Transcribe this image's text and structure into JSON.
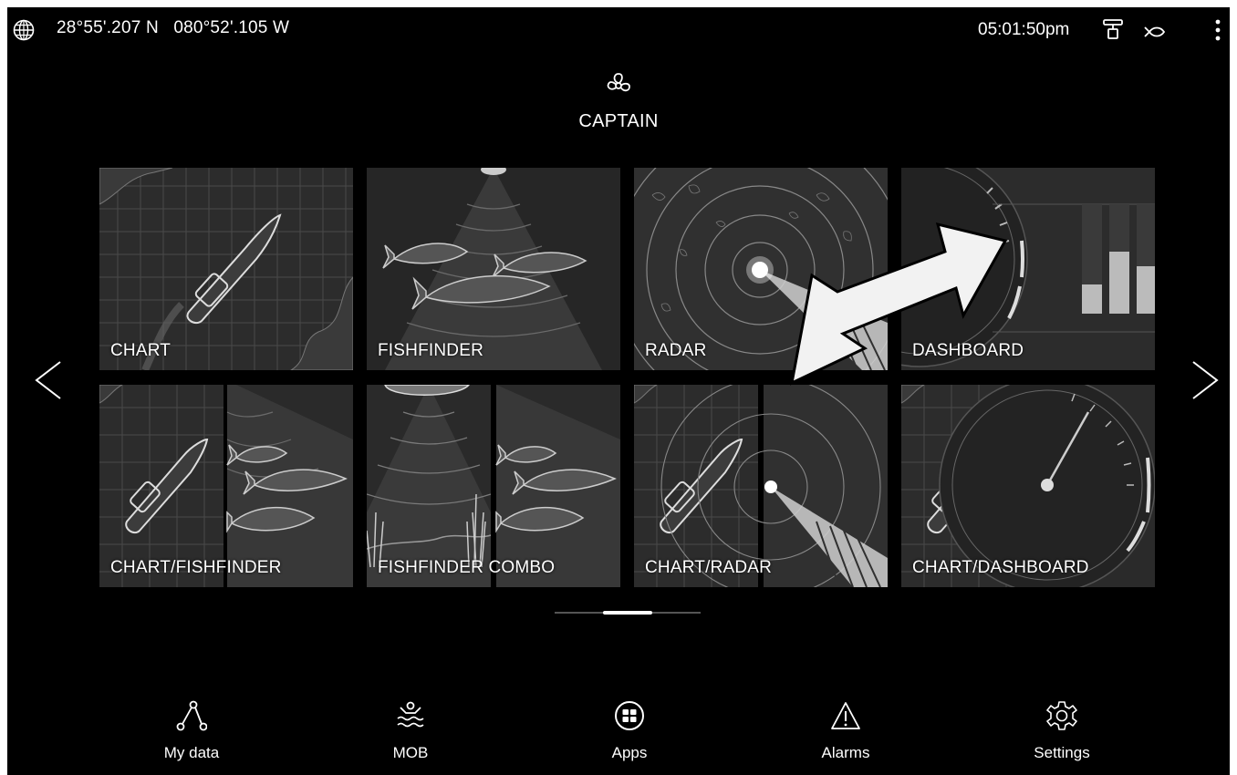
{
  "statusbar": {
    "latitude": "28°55'.207 N",
    "longitude": "080°52'.105 W",
    "time": "05:01:50pm",
    "icons": [
      "globe-icon",
      "radar-scanner-icon",
      "fish-icon",
      "more-vertical-icon"
    ]
  },
  "profile": {
    "icon": "propeller-icon",
    "name": "CAPTAIN"
  },
  "tiles": [
    {
      "id": "chart",
      "label": "CHART"
    },
    {
      "id": "fishfinder",
      "label": "FISHFINDER"
    },
    {
      "id": "radar",
      "label": "RADAR"
    },
    {
      "id": "dashboard",
      "label": "DASHBOARD"
    },
    {
      "id": "chart-fishfinder",
      "label": "CHART/FISHFINDER"
    },
    {
      "id": "fishfinder-combo",
      "label": "FISHFINDER COMBO"
    },
    {
      "id": "chart-radar",
      "label": "CHART/RADAR"
    },
    {
      "id": "chart-dashboard",
      "label": "CHART/DASHBOARD"
    }
  ],
  "pager": {
    "pages": 3,
    "current": 2
  },
  "dock": [
    {
      "id": "my-data",
      "label": "My data",
      "icon": "data-network-icon"
    },
    {
      "id": "mob",
      "label": "MOB",
      "icon": "man-overboard-icon"
    },
    {
      "id": "apps",
      "label": "Apps",
      "icon": "apps-grid-icon"
    },
    {
      "id": "alarms",
      "label": "Alarms",
      "icon": "warning-icon"
    },
    {
      "id": "settings",
      "label": "Settings",
      "icon": "gear-icon"
    }
  ],
  "colors": {
    "background": "#000000",
    "tile": "#2a2a2a",
    "text": "#ffffff",
    "annotation_arrow": "#ffffff"
  }
}
